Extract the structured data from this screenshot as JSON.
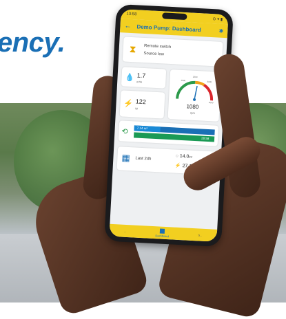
{
  "headline": "ency.",
  "phone": {
    "status": {
      "time": "13:58",
      "left_icons": "≡ ≡ ◌ ▣ •",
      "right_icons": "⊙ ▾ ▮"
    },
    "appbar": {
      "title": "Demo Pump: Dashboard",
      "back_icon": "arrow-left-icon",
      "bluetooth_icon": "bluetooth-icon"
    },
    "source_card": {
      "line1": "Remote switch",
      "line2": "Source low",
      "icon": "hourglass-icon"
    },
    "flow_card": {
      "value": "1.7",
      "unit": "m³/h",
      "icon": "drop-icon"
    },
    "power_card": {
      "value": "122",
      "unit": "W",
      "icon": "bolt-icon"
    },
    "gauge_card": {
      "value": "1080",
      "unit": "rpm",
      "ticks": [
        "1000",
        "2000",
        "3000",
        "4000"
      ]
    },
    "bars_card": {
      "volume": "7.14 m³",
      "time": "28:58",
      "progress": 0.32
    },
    "last24_card": {
      "label": "Last 24h",
      "volume": "14.0",
      "volume_unit": "m³",
      "energy": "27.1",
      "energy_unit": "kWh"
    },
    "navbar": {
      "items": [
        "...",
        "Dashboard",
        "S..."
      ],
      "active_index": 1
    }
  },
  "colors": {
    "accent_yellow": "#f2cf20",
    "brand_blue": "#1a6fb5",
    "green": "#1a9a55"
  }
}
